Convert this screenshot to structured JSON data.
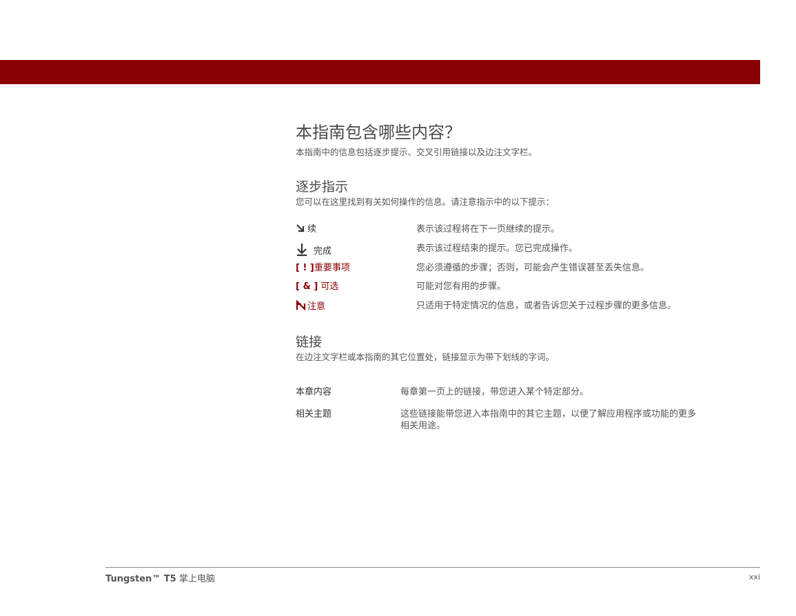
{
  "page": {
    "title": "本指南包含哪些内容？",
    "intro": "本指南中的信息包括逐步提示、交叉引用链接以及边注文字栏。"
  },
  "steps": {
    "heading": "逐步指示",
    "intro": "您可以在这里找到有关如何操作的信息。请注意指示中的以下提示：",
    "items": [
      {
        "icon": "arrow-continue-icon",
        "label": "续",
        "desc": "表示该过程将在下一页继续的提示。"
      },
      {
        "icon": "arrow-done-icon",
        "label": "完成",
        "desc": "表示该过程结束的提示。您已完成操作。"
      },
      {
        "icon_text": "[ ! ]",
        "label": "重要事项",
        "desc": "您必须遵循的步骤；否则，可能会产生错误甚至丢失信息。"
      },
      {
        "icon_text": "[ & ]",
        "label": "可选",
        "desc": "可能对您有用的步骤。"
      },
      {
        "icon": "note-icon",
        "label": "注意",
        "desc": "只适用于特定情况的信息，或者告诉您关于过程步骤的更多信息。"
      }
    ]
  },
  "links": {
    "heading": "链接",
    "intro": "在边注文字栏或本指南的其它位置处，链接显示为带下划线的字词。",
    "items": [
      {
        "label": "本章内容",
        "desc": "每章第一页上的链接，带您进入某个特定部分。"
      },
      {
        "label": "相关主题",
        "desc": "这些链接能带您进入本指南中的其它主题，以便了解应用程序或功能的更多",
        "desc2": "相关用途。"
      }
    ]
  },
  "footer": {
    "brand": "Tungsten™ T5",
    "product": " 掌上电脑",
    "page_number": "xxi"
  },
  "colors": {
    "accent": "#8b0000"
  }
}
